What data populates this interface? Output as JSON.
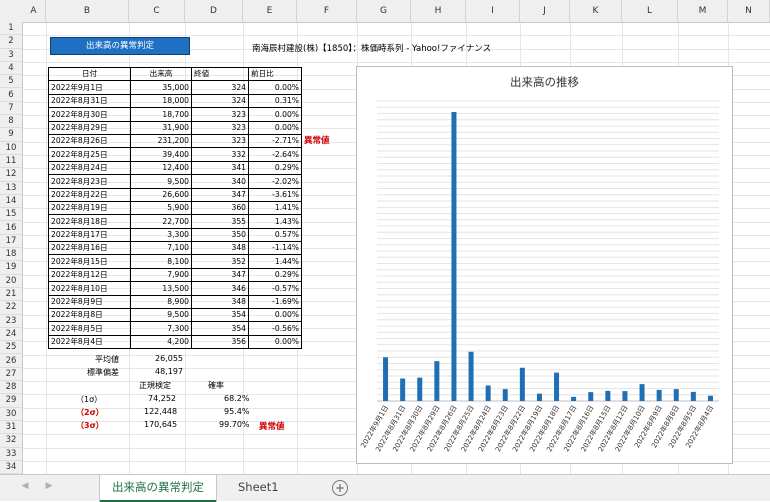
{
  "columns": [
    "A",
    "B",
    "C",
    "D",
    "E",
    "F",
    "G",
    "H",
    "I",
    "J",
    "K",
    "L",
    "M",
    "N"
  ],
  "rows": [
    "1",
    "2",
    "3",
    "4",
    "5",
    "6",
    "7",
    "8",
    "9",
    "10",
    "11",
    "12",
    "13",
    "14",
    "15",
    "16",
    "17",
    "18",
    "19",
    "20",
    "21",
    "22",
    "23",
    "24",
    "25",
    "26",
    "27",
    "28",
    "29",
    "30",
    "31",
    "32",
    "33",
    "34"
  ],
  "button_label": "出来高の異常判定",
  "sheet_title": "南海辰村建設(株)【1850】：株価時系列 - Yahoo!ファイナンス",
  "table": {
    "headers": [
      "日付",
      "出来高",
      "終値",
      "前日比"
    ],
    "rows": [
      {
        "date": "2022年9月1日",
        "volume": "35,000",
        "close": "324",
        "change": "0.00%"
      },
      {
        "date": "2022年8月31日",
        "volume": "18,000",
        "close": "324",
        "change": "0.31%"
      },
      {
        "date": "2022年8月30日",
        "volume": "18,700",
        "close": "323",
        "change": "0.00%"
      },
      {
        "date": "2022年8月29日",
        "volume": "31,900",
        "close": "323",
        "change": "0.00%"
      },
      {
        "date": "2022年8月26日",
        "volume": "231,200",
        "close": "323",
        "change": "-2.71%"
      },
      {
        "date": "2022年8月25日",
        "volume": "39,400",
        "close": "332",
        "change": "-2.64%"
      },
      {
        "date": "2022年8月24日",
        "volume": "12,400",
        "close": "341",
        "change": "0.29%"
      },
      {
        "date": "2022年8月23日",
        "volume": "9,500",
        "close": "340",
        "change": "-2.02%"
      },
      {
        "date": "2022年8月22日",
        "volume": "26,600",
        "close": "347",
        "change": "-3.61%"
      },
      {
        "date": "2022年8月19日",
        "volume": "5,900",
        "close": "360",
        "change": "1.41%"
      },
      {
        "date": "2022年8月18日",
        "volume": "22,700",
        "close": "355",
        "change": "1.43%"
      },
      {
        "date": "2022年8月17日",
        "volume": "3,300",
        "close": "350",
        "change": "0.57%"
      },
      {
        "date": "2022年8月16日",
        "volume": "7,100",
        "close": "348",
        "change": "-1.14%"
      },
      {
        "date": "2022年8月15日",
        "volume": "8,100",
        "close": "352",
        "change": "1.44%"
      },
      {
        "date": "2022年8月12日",
        "volume": "7,900",
        "close": "347",
        "change": "0.29%"
      },
      {
        "date": "2022年8月10日",
        "volume": "13,500",
        "close": "346",
        "change": "-0.57%"
      },
      {
        "date": "2022年8月9日",
        "volume": "8,900",
        "close": "348",
        "change": "-1.69%"
      },
      {
        "date": "2022年8月8日",
        "volume": "9,500",
        "close": "354",
        "change": "0.00%"
      },
      {
        "date": "2022年8月5日",
        "volume": "7,300",
        "close": "354",
        "change": "-0.56%"
      },
      {
        "date": "2022年8月4日",
        "volume": "4,200",
        "close": "356",
        "change": "0.00%"
      }
    ]
  },
  "anomaly_label": "異常値",
  "stats": {
    "mean_label": "平均値",
    "mean_value": "26,055",
    "sd_label": "標準偏差",
    "sd_value": "48,197",
    "normal_header": "正規検定",
    "prob_header": "確率",
    "sigma1_label": "（1σ）",
    "sigma1_value": "74,252",
    "sigma1_prob": "68.2%",
    "sigma2_label": "（2σ）",
    "sigma2_value": "122,448",
    "sigma2_prob": "95.4%",
    "sigma3_label": "（3σ）",
    "sigma3_value": "170,645",
    "sigma3_prob": "99.70%"
  },
  "chart_data": {
    "type": "bar",
    "title": "出来高の推移",
    "categories": [
      "2022年9月1日",
      "2022年8月31日",
      "2022年8月30日",
      "2022年8月29日",
      "2022年8月26日",
      "2022年8月25日",
      "2022年8月24日",
      "2022年8月23日",
      "2022年8月22日",
      "2022年8月19日",
      "2022年8月18日",
      "2022年8月17日",
      "2022年8月16日",
      "2022年8月15日",
      "2022年8月12日",
      "2022年8月10日",
      "2022年8月9日",
      "2022年8月8日",
      "2022年8月5日",
      "2022年8月4日"
    ],
    "values": [
      35000,
      18000,
      18700,
      31900,
      231200,
      39400,
      12400,
      9500,
      26600,
      5900,
      22700,
      3300,
      7100,
      8100,
      7900,
      13500,
      8900,
      9500,
      7300,
      4200
    ],
    "bar_color": "#1f6fb4",
    "grid": true
  },
  "tabs": [
    {
      "label": "出来高の異常判定",
      "active": true
    },
    {
      "label": "Sheet1",
      "active": false
    }
  ],
  "add_sheet_icon": "plus-circle-icon"
}
